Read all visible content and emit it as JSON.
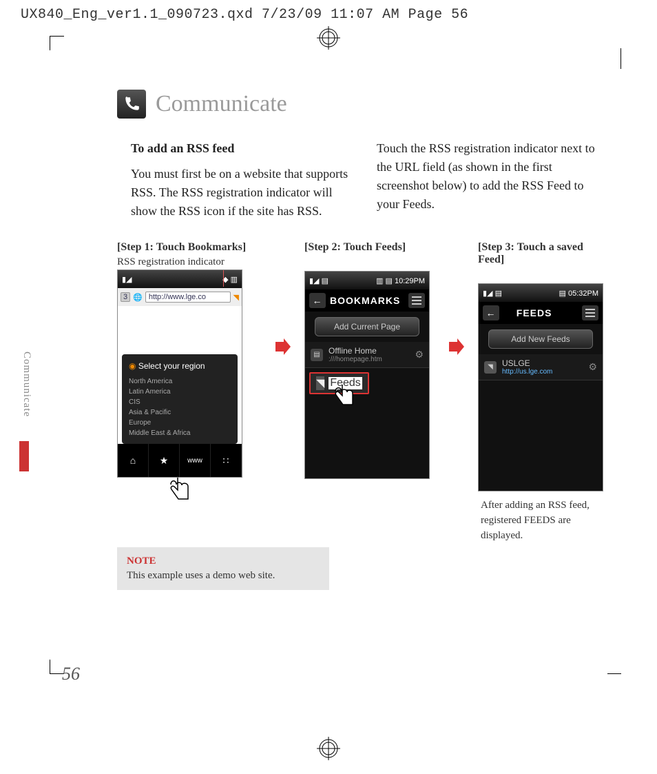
{
  "header": "UX840_Eng_ver1.1_090723.qxd  7/23/09  11:07 AM  Page 56",
  "title": "Communicate",
  "side_tab": "Communicate",
  "page_number": "56",
  "left_col": {
    "heading": "To add an RSS feed",
    "body": "You must first be on a website that supports RSS. The RSS registration indicator will show the RSS icon if the site has RSS."
  },
  "right_col": {
    "body": "Touch the RSS registration indicator next to the URL field (as shown in the first screenshot below) to add the RSS Feed to your Feeds."
  },
  "steps": {
    "s1": {
      "label": "[Step 1: Touch Bookmarks]",
      "sub": "RSS registration indicator",
      "url": "http://www.lge.co",
      "region_head": "Select your region",
      "regions": [
        "North America",
        "Latin America",
        "CIS",
        "Asia & Pacific",
        "Europe",
        "Middle East & Africa"
      ],
      "bottom": [
        "‹",
        "›",
        "↻",
        "⊕",
        "⌂",
        "★",
        "www",
        "∷"
      ]
    },
    "s2": {
      "label": "[Step 2: Touch Feeds]",
      "time": "10:29PM",
      "head": "BOOKMARKS",
      "btn": "Add Current Page",
      "item_title": "Offline Home",
      "item_sub": ":///homepage.htm",
      "feeds_label": "Feeds"
    },
    "s3": {
      "label": "[Step 3: Touch a saved Feed]",
      "time": "05:32PM",
      "head": "FEEDS",
      "btn": "Add New Feeds",
      "item_title": "USLGE",
      "item_sub": "http://us.lge.com",
      "after": "After adding an RSS feed, registered FEEDS are displayed."
    }
  },
  "note": {
    "label": "NOTE",
    "body": "This example uses a demo web site."
  }
}
